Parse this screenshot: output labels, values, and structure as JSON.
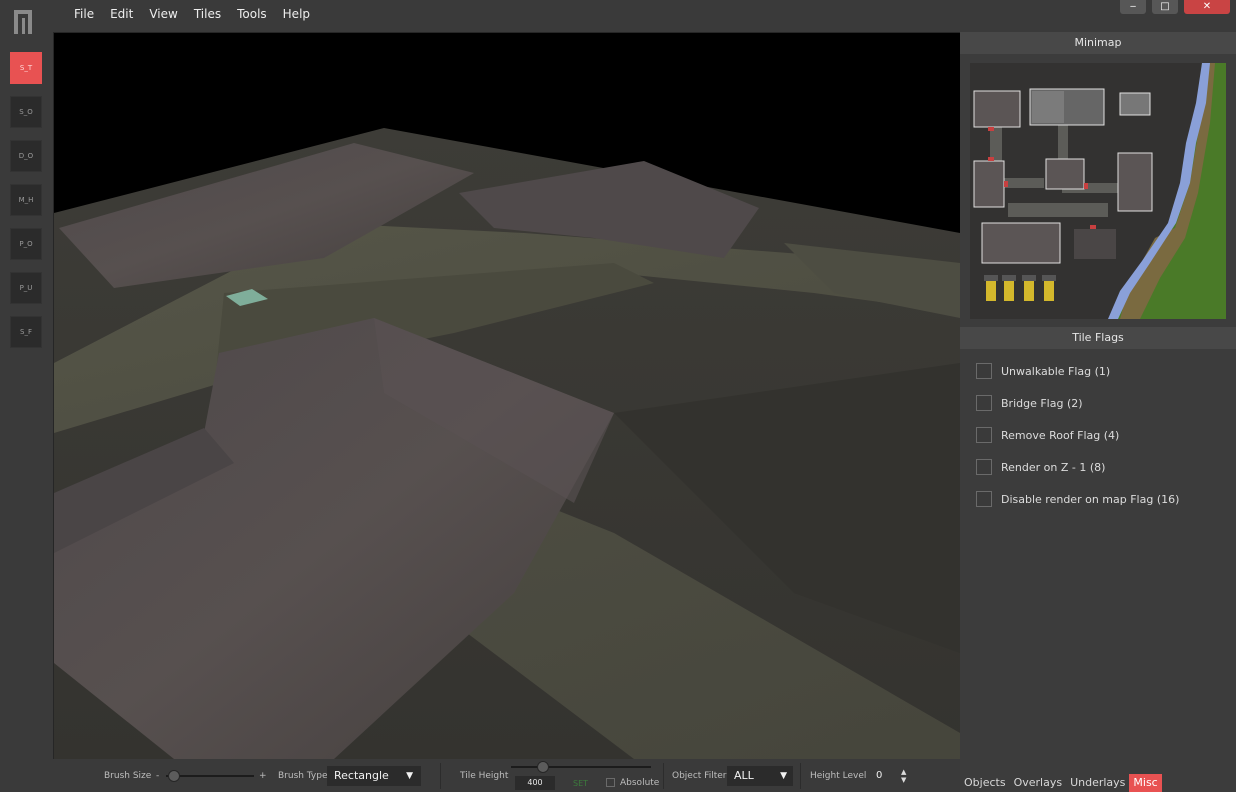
{
  "menu": [
    "File",
    "Edit",
    "View",
    "Tiles",
    "Tools",
    "Help"
  ],
  "window_controls": {
    "minimize": "‒",
    "maximize": "□",
    "close": "✕"
  },
  "tools": [
    "S_T",
    "S_O",
    "D_O",
    "M_H",
    "P_O",
    "P_U",
    "S_F"
  ],
  "minimap": {
    "title": "Minimap"
  },
  "tile_flags": {
    "title": "Tile Flags",
    "items": [
      "Unwalkable Flag (1)",
      "Bridge Flag (2)",
      "Remove Roof Flag (4)",
      "Render on Z - 1 (8)",
      "Disable render on map Flag (16)"
    ]
  },
  "tabs": [
    "Objects",
    "Overlays",
    "Underlays",
    "Misc"
  ],
  "bottombar": {
    "brush_size_label": "Brush Size",
    "brush_minus": "-",
    "brush_plus": "+",
    "brush_size_value": 0.02,
    "brush_type_label": "Brush Type",
    "brush_type_value": "Rectangle",
    "tile_height_label": "Tile Height",
    "tile_height_value": "400",
    "tile_height_slider": 0.2,
    "set_label": "SET",
    "absolute_label": "Absolute",
    "object_filter_label": "Object Filter",
    "object_filter_value": "ALL",
    "height_level_label": "Height Level",
    "height_level_value": "0"
  },
  "colors": {
    "accent": "#e85252",
    "panel": "#3c3c3c",
    "header": "#484848"
  }
}
